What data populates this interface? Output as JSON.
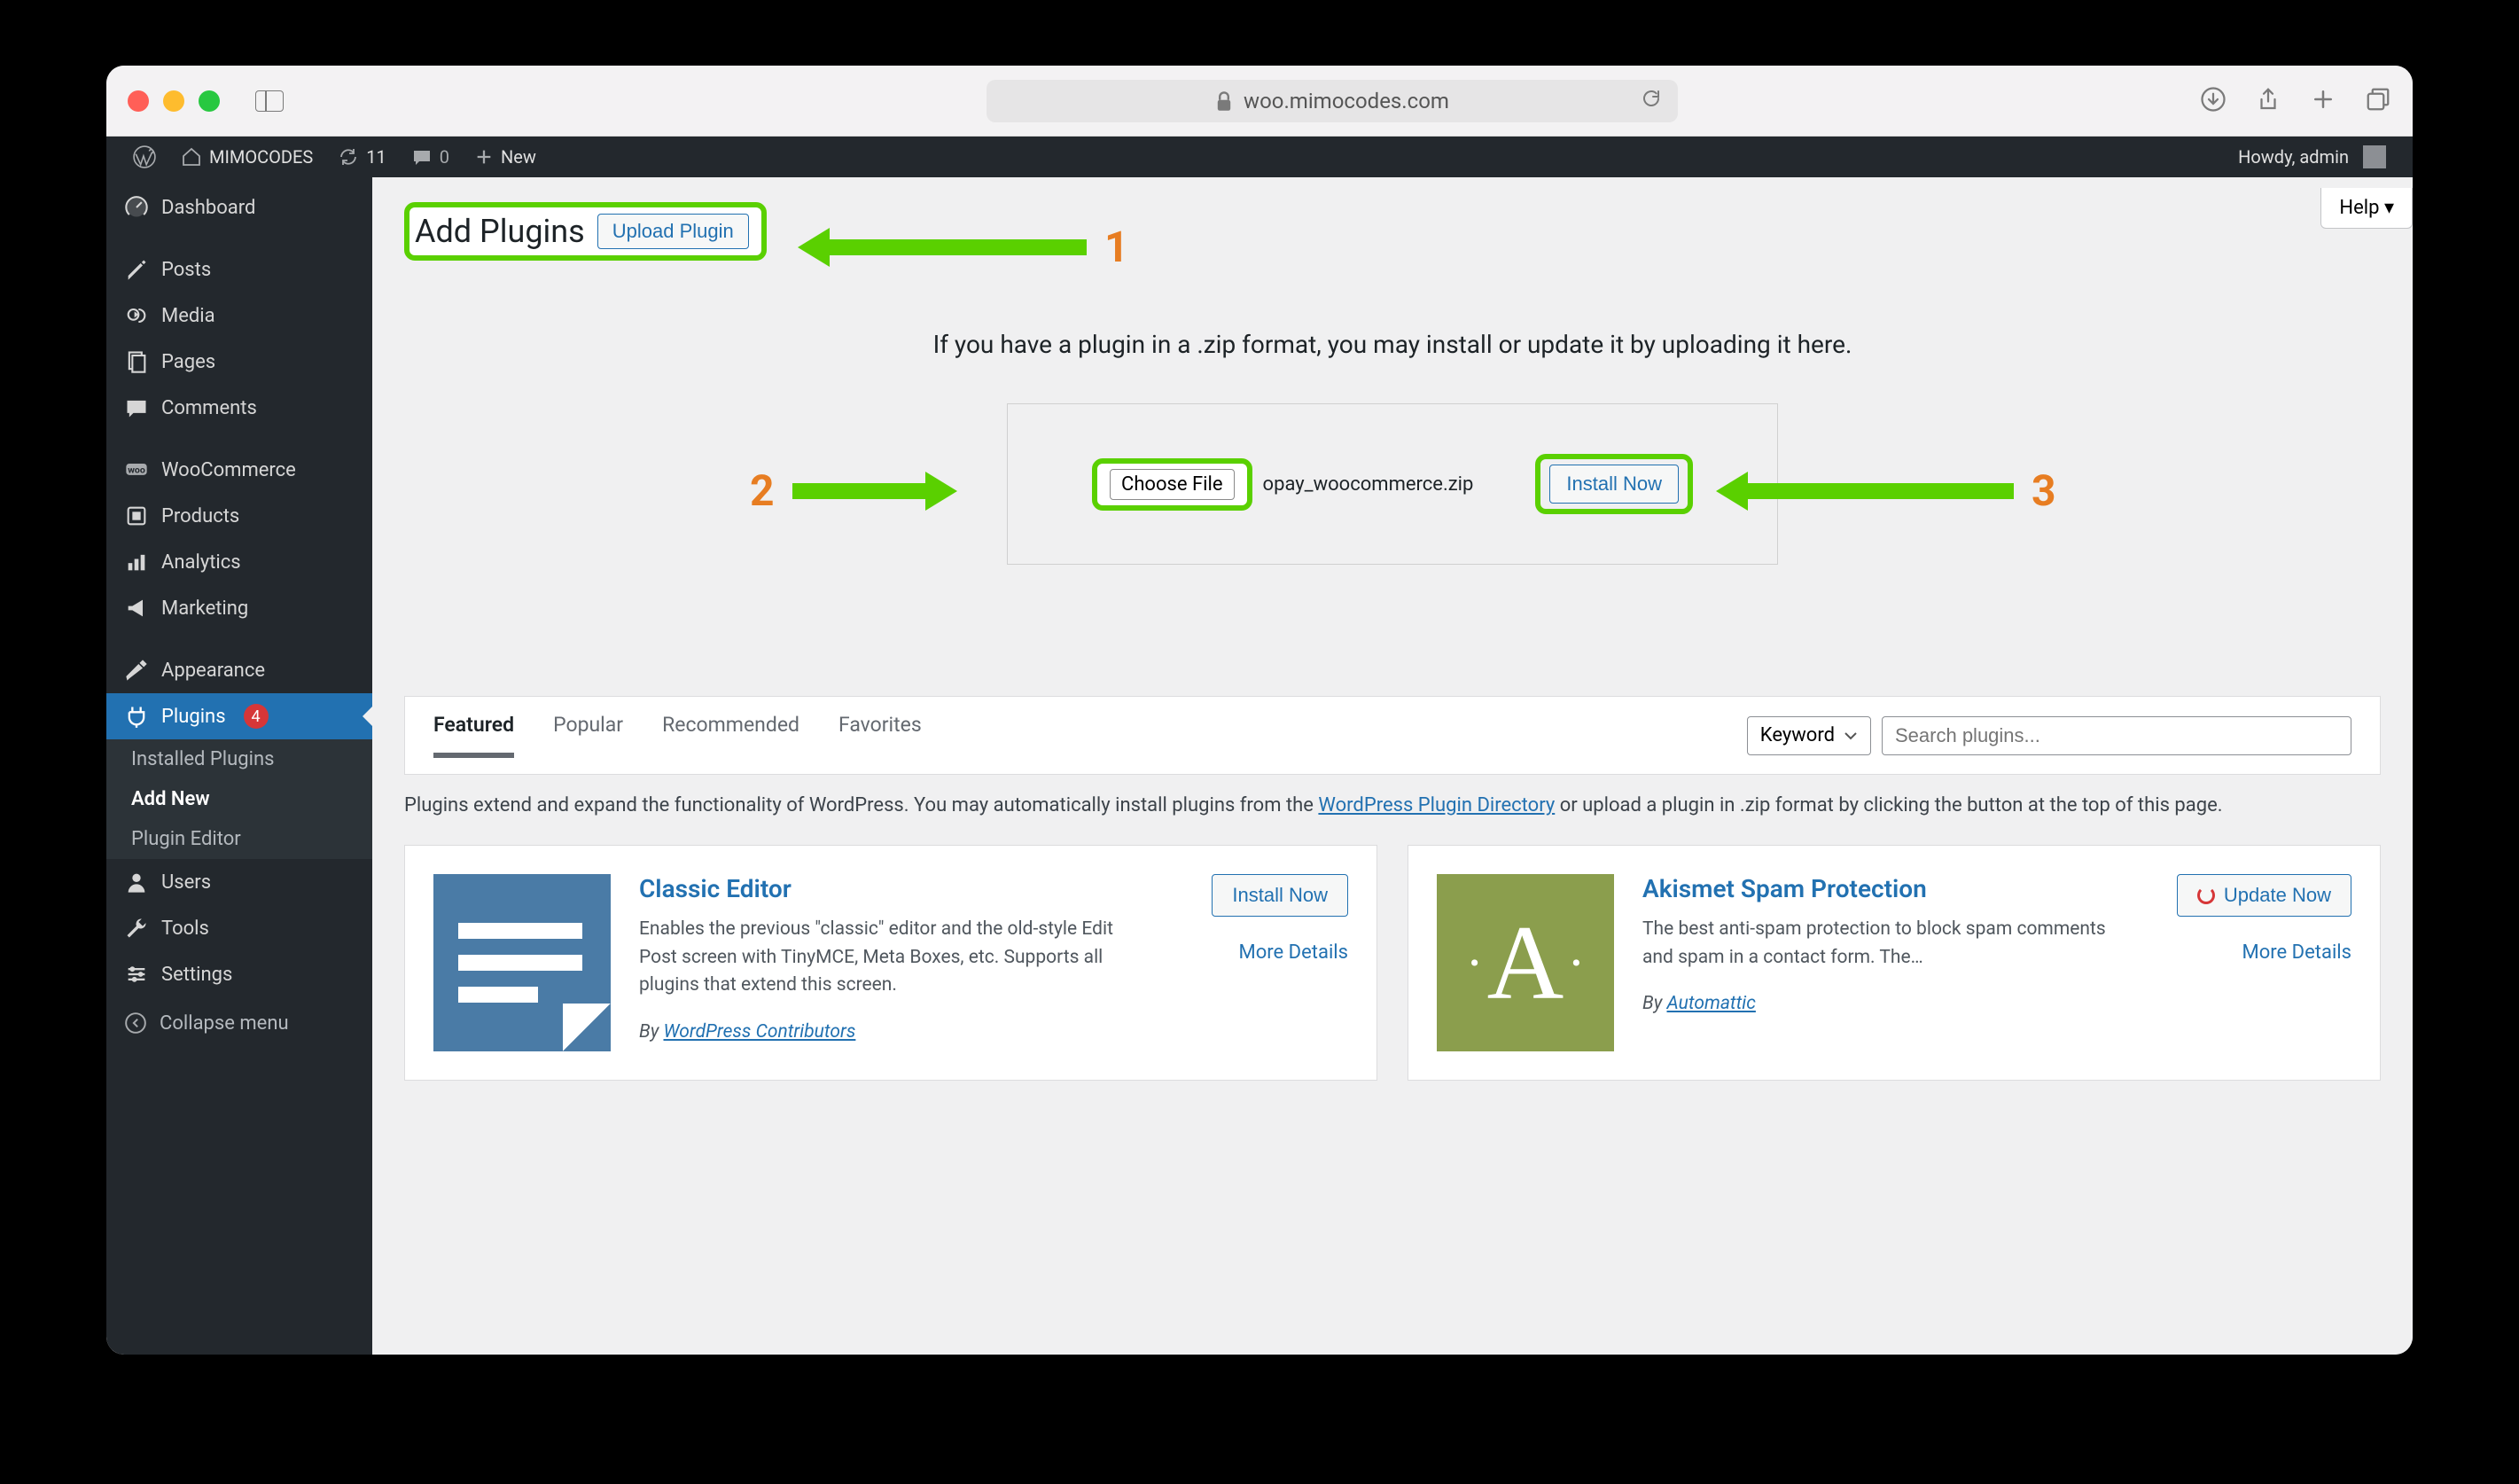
{
  "browser": {
    "url": "woo.mimocodes.com"
  },
  "adminbar": {
    "site_name": "MIMOCODES",
    "updates_count": "11",
    "comments_count": "0",
    "new_label": "New",
    "howdy": "Howdy, admin"
  },
  "sidebar": {
    "dashboard": "Dashboard",
    "posts": "Posts",
    "media": "Media",
    "pages": "Pages",
    "comments": "Comments",
    "woocommerce": "WooCommerce",
    "products": "Products",
    "analytics": "Analytics",
    "marketing": "Marketing",
    "appearance": "Appearance",
    "plugins": "Plugins",
    "plugins_badge": "4",
    "plugins_sub": {
      "installed": "Installed Plugins",
      "add_new": "Add New",
      "editor": "Plugin Editor"
    },
    "users": "Users",
    "tools": "Tools",
    "settings": "Settings",
    "collapse": "Collapse menu"
  },
  "header": {
    "title": "Add Plugins",
    "upload_button": "Upload Plugin",
    "help": "Help"
  },
  "annotations": {
    "a1": "1",
    "a2": "2",
    "a3": "3"
  },
  "upload": {
    "instructions": "If you have a plugin in a .zip format, you may install or update it by uploading it here.",
    "choose_file": "Choose File",
    "file_name": "opay_woocommerce.zip",
    "install_now": "Install Now"
  },
  "filter": {
    "featured": "Featured",
    "popular": "Popular",
    "recommended": "Recommended",
    "favorites": "Favorites",
    "keyword": "Keyword",
    "search_placeholder": "Search plugins..."
  },
  "helptext": {
    "pre": "Plugins extend and expand the functionality of WordPress. You may automatically install plugins from the ",
    "link": "WordPress Plugin Directory",
    "post": " or upload a plugin in .zip format by clicking the button at the top of this page."
  },
  "cards": {
    "classic": {
      "name": "Classic Editor",
      "desc": "Enables the previous \"classic\" editor and the old-style Edit Post screen with TinyMCE, Meta Boxes, etc. Supports all plugins that extend this screen.",
      "install": "Install Now",
      "details": "More Details",
      "by_pre": "By ",
      "by": "WordPress Contributors"
    },
    "akismet": {
      "name": "Akismet Spam Protection",
      "desc": "The best anti-spam protection to block spam comments and spam in a contact form. The…",
      "update": "Update Now",
      "details": "More Details",
      "by_pre": "By ",
      "by": "Automattic"
    }
  }
}
